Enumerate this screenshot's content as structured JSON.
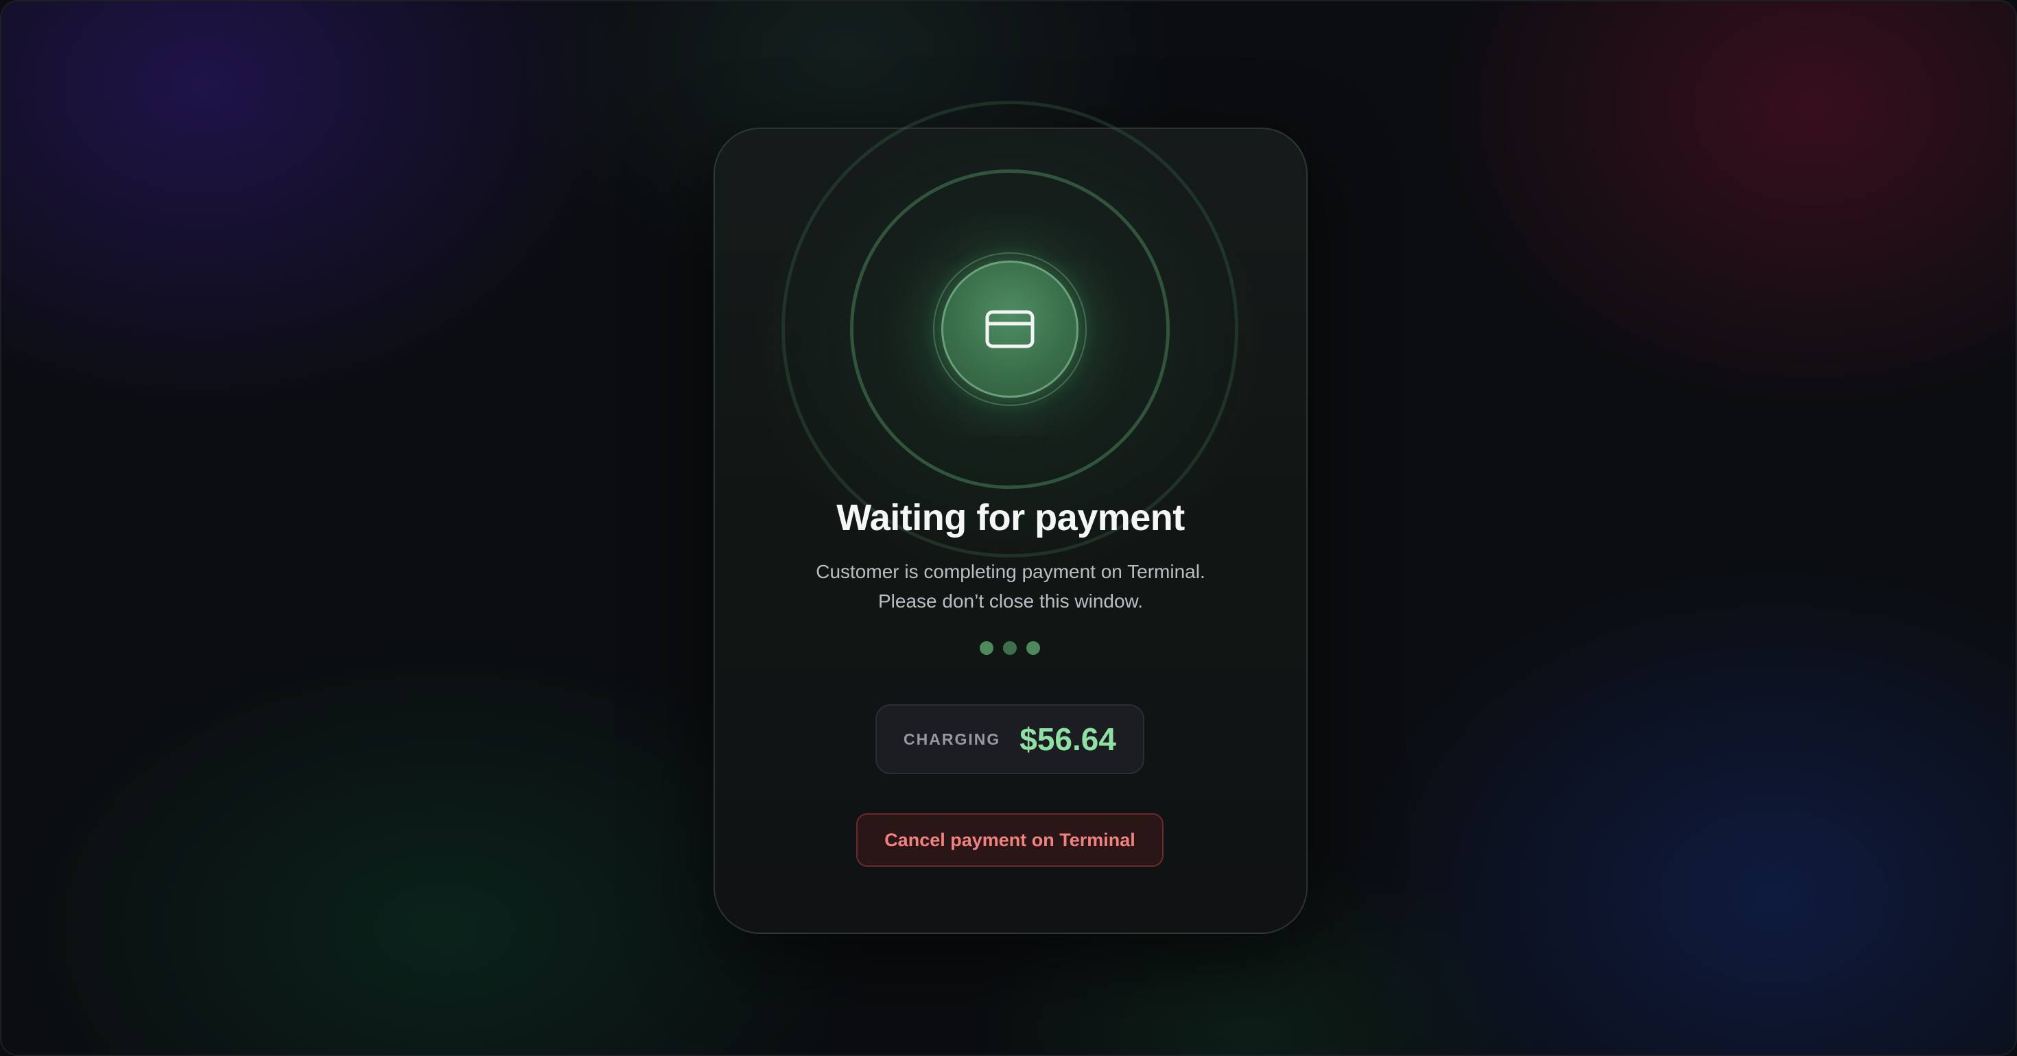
{
  "payment": {
    "title": "Waiting for payment",
    "subtitle_line1": "Customer is completing payment on Terminal.",
    "subtitle_line2": "Please don’t close this window.",
    "charging_label": "CHARGING",
    "amount": "$56.64",
    "cancel_label": "Cancel payment on Terminal",
    "icon": "credit-card-icon",
    "progress_dots": 3
  },
  "colors": {
    "accent_green": "#8fe0a2",
    "icon_green": "#3a6f4b",
    "cancel_text": "#f0837f",
    "cancel_border": "#6b2a2c",
    "card_background": "#121715"
  }
}
